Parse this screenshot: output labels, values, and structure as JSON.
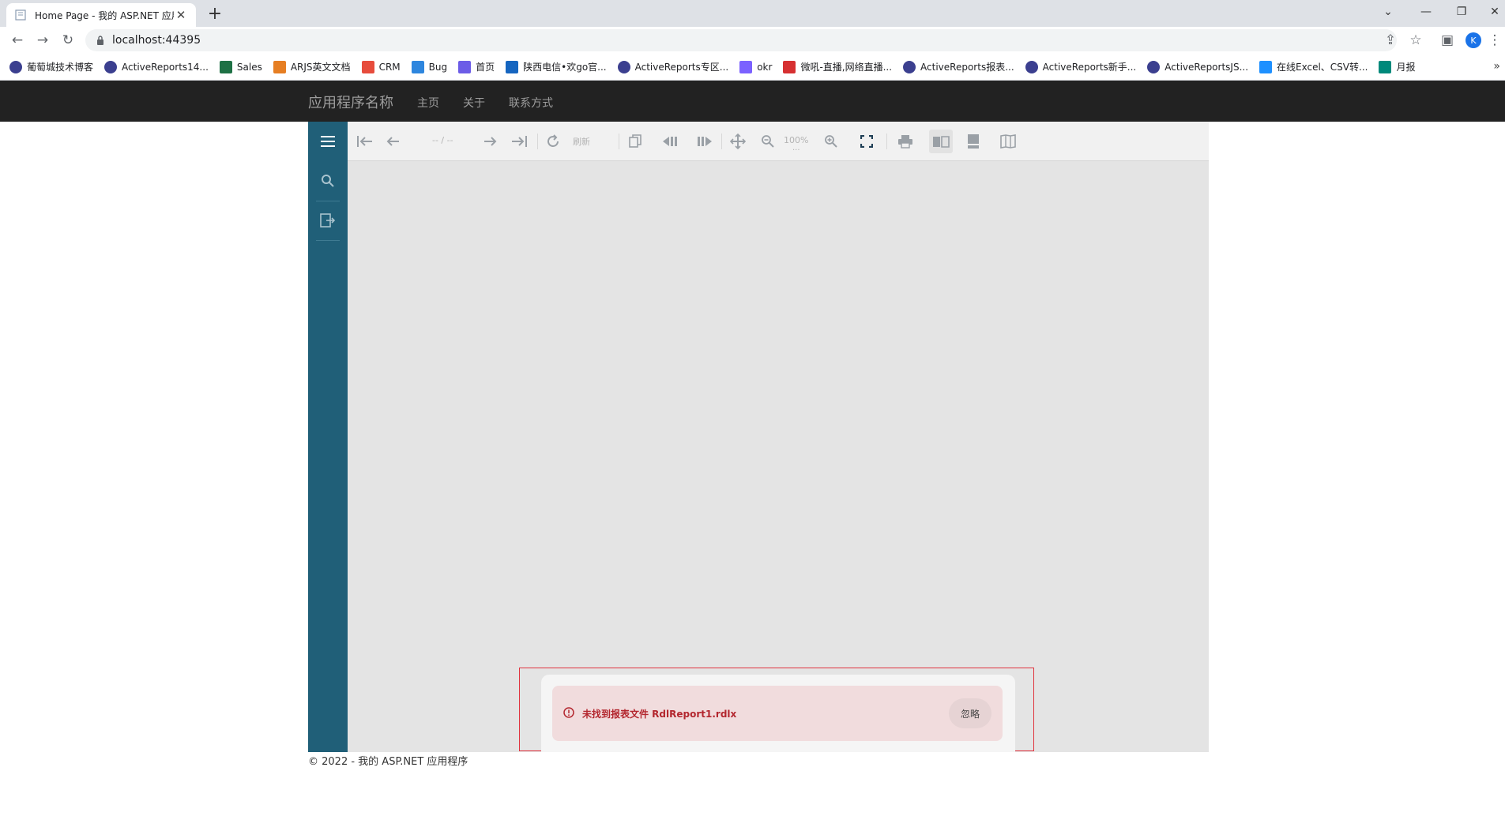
{
  "browser": {
    "tab_title": "Home Page - 我的 ASP.NET 应用程序",
    "url": "localhost:44395",
    "bookmarks": [
      {
        "label": "葡萄城技术博客",
        "icon": "activereports-icon",
        "color": "#3b3f8f"
      },
      {
        "label": "ActiveReports14...",
        "icon": "activereports-icon",
        "color": "#3b3f8f"
      },
      {
        "label": "Sales",
        "icon": "excel-icon",
        "color": "#1e7145"
      },
      {
        "label": "ARJS英文文档",
        "icon": "arjs-icon",
        "color": "#e67e22"
      },
      {
        "label": "CRM",
        "icon": "windows-icon",
        "color": "#e74c3c"
      },
      {
        "label": "Bug",
        "icon": "diamond-icon",
        "color": "#2e86de"
      },
      {
        "label": "首页",
        "icon": "page-icon",
        "color": "#6c5ce7"
      },
      {
        "label": "陕西电信•欢go官...",
        "icon": "telecom-icon",
        "color": "#1565c0"
      },
      {
        "label": "ActiveReports专区...",
        "icon": "activereports-icon",
        "color": "#3b3f8f"
      },
      {
        "label": "okr",
        "icon": "okr-icon",
        "color": "#7b61ff"
      },
      {
        "label": "微吼-直播,网络直播...",
        "icon": "vhall-icon",
        "color": "#d63031"
      },
      {
        "label": "ActiveReports报表...",
        "icon": "activereports-icon",
        "color": "#3b3f8f"
      },
      {
        "label": "ActiveReports新手...",
        "icon": "activereports-icon",
        "color": "#3b3f8f"
      },
      {
        "label": "ActiveReportsJS...",
        "icon": "activereports-icon",
        "color": "#3b3f8f"
      },
      {
        "label": "在线Excel、CSV转...",
        "icon": "b-icon",
        "color": "#1e90ff"
      },
      {
        "label": "月报",
        "icon": "s-icon",
        "color": "#00897b"
      }
    ],
    "profile_initial": "K"
  },
  "site": {
    "brand": "应用程序名称",
    "nav": [
      "主页",
      "关于",
      "联系方式"
    ],
    "footer": "© 2022 - 我的 ASP.NET 应用程序"
  },
  "viewer": {
    "page_indicator": "-- / --",
    "refresh_label": "刷新",
    "zoom": "100%",
    "zoom_more": "...",
    "error_message": "未找到报表文件 RdlReport1.rdlx",
    "dismiss_label": "忽略"
  },
  "colors": {
    "navbar": "#222222",
    "sidebar": "#205f78",
    "viewer_bg": "#e4e4e4",
    "error_text": "#b3262e",
    "error_border": "#e0343f"
  }
}
